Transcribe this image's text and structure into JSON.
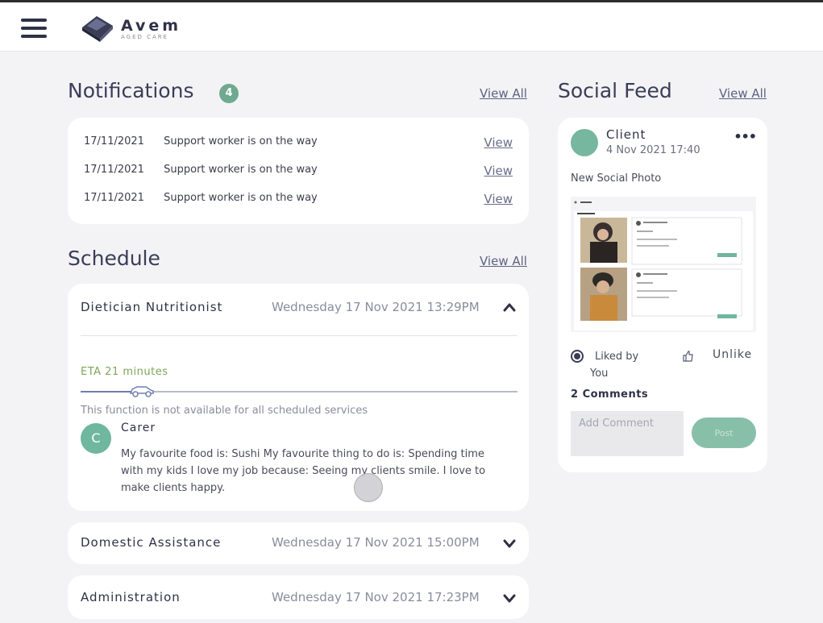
{
  "header": {
    "logo_name": "Avem",
    "logo_sub": "AGED CARE"
  },
  "notifications": {
    "title": "Notifications",
    "count": "4",
    "view_all": "View All",
    "items": [
      {
        "date": "17/11/2021",
        "text": "Support worker is on the way",
        "action": "View"
      },
      {
        "date": "17/11/2021",
        "text": "Support worker is on the way",
        "action": "View"
      },
      {
        "date": "17/11/2021",
        "text": "Support worker is on the way",
        "action": "View"
      }
    ]
  },
  "schedule": {
    "title": "Schedule",
    "view_all": "View All",
    "items": [
      {
        "name": "Dietician Nutritionist",
        "datetime": "Wednesday 17 Nov 2021  13:29PM",
        "expanded": true
      },
      {
        "name": "Domestic Assistance",
        "datetime": "Wednesday 17 Nov 2021  15:00PM",
        "expanded": false
      },
      {
        "name": "Administration",
        "datetime": "Wednesday 17 Nov 2021  17:23PM",
        "expanded": false
      }
    ],
    "detail": {
      "eta": "ETA 21 minutes",
      "progress": 0.14,
      "notice": "This function is not available for all scheduled services",
      "carer_initial": "C",
      "carer_label": "Carer",
      "carer_text": "My favourite food is: Sushi My favourite thing to do is: Spending time with my kids I love my job because: Seeing my clients smile. I love to make clients happy."
    }
  },
  "social_feed": {
    "title": "Social Feed",
    "view_all": "View All",
    "post": {
      "author": "Client",
      "date": "4 Nov 2021 17:40",
      "caption": "New Social Photo",
      "liked_by": "Liked by You",
      "unlike": "Unlike",
      "comments_title": "2 Comments",
      "comment_placeholder": "Add Comment",
      "post_button": "Post"
    }
  },
  "colors": {
    "accent_green": "#6fa990",
    "eta_green": "#7ea55a",
    "title_navy": "#3b3d58",
    "background": "#f3f3f5"
  }
}
